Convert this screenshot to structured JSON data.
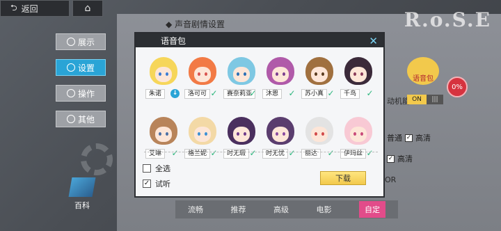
{
  "topbar": {
    "back_label": "返回"
  },
  "logo": "R.o.S.E",
  "sidebar": {
    "items": [
      {
        "label": "展示"
      },
      {
        "label": "设置"
      },
      {
        "label": "操作"
      },
      {
        "label": "其他"
      }
    ],
    "encyclopedia_label": "百科"
  },
  "background": {
    "section_title": "声音剧情设置",
    "voice_badge": "语音包",
    "percent": "0%",
    "feature_label": "动机能",
    "toggle_on": "ON",
    "quality_normal": "普通",
    "quality_hd": "高清",
    "quality_hd2": "高清",
    "or_text": "OR",
    "tabs": [
      "流畅",
      "推荐",
      "高级",
      "电影",
      "自定"
    ]
  },
  "modal": {
    "title": "语音包",
    "characters": [
      {
        "name": "朱诺",
        "state": "download",
        "hair": "#f6d65a",
        "eye": "#3a7bd5"
      },
      {
        "name": "洛可可",
        "state": "check",
        "hair": "#f27a45",
        "eye": "#d9534f"
      },
      {
        "name": "赛奈莉亚",
        "state": "check",
        "hair": "#7ec8e3",
        "eye": "#2a6fb5"
      },
      {
        "name": "沐恩",
        "state": "check",
        "hair": "#b05aa9",
        "eye": "#7b3d8f"
      },
      {
        "name": "苏小真",
        "state": "check",
        "hair": "#a0703f",
        "eye": "#5a3b1f"
      },
      {
        "name": "千鸟",
        "state": "check",
        "hair": "#3b2a3a",
        "eye": "#8a3b5a"
      },
      {
        "name": "艾琳",
        "state": "check",
        "hair": "#b8845a",
        "eye": "#4a6fa5"
      },
      {
        "name": "格兰妮",
        "state": "check",
        "hair": "#f3d9a6",
        "eye": "#3a8fd5"
      },
      {
        "name": "时无瑕",
        "state": "check",
        "hair": "#4a2f5e",
        "eye": "#6e3a8a"
      },
      {
        "name": "时无忧",
        "state": "check",
        "hair": "#5a3d6e",
        "eye": "#8a4aa0"
      },
      {
        "name": "丽达",
        "state": "check",
        "hair": "#e3e3e3",
        "eye": "#d24a4a"
      },
      {
        "name": "伊玛丝",
        "state": "check",
        "hair": "#f8c9d4",
        "eye": "#c94a7a"
      }
    ],
    "select_all_label": "全选",
    "preview_label": "试听",
    "preview_checked": true,
    "select_all_checked": false,
    "download_label": "下载"
  }
}
